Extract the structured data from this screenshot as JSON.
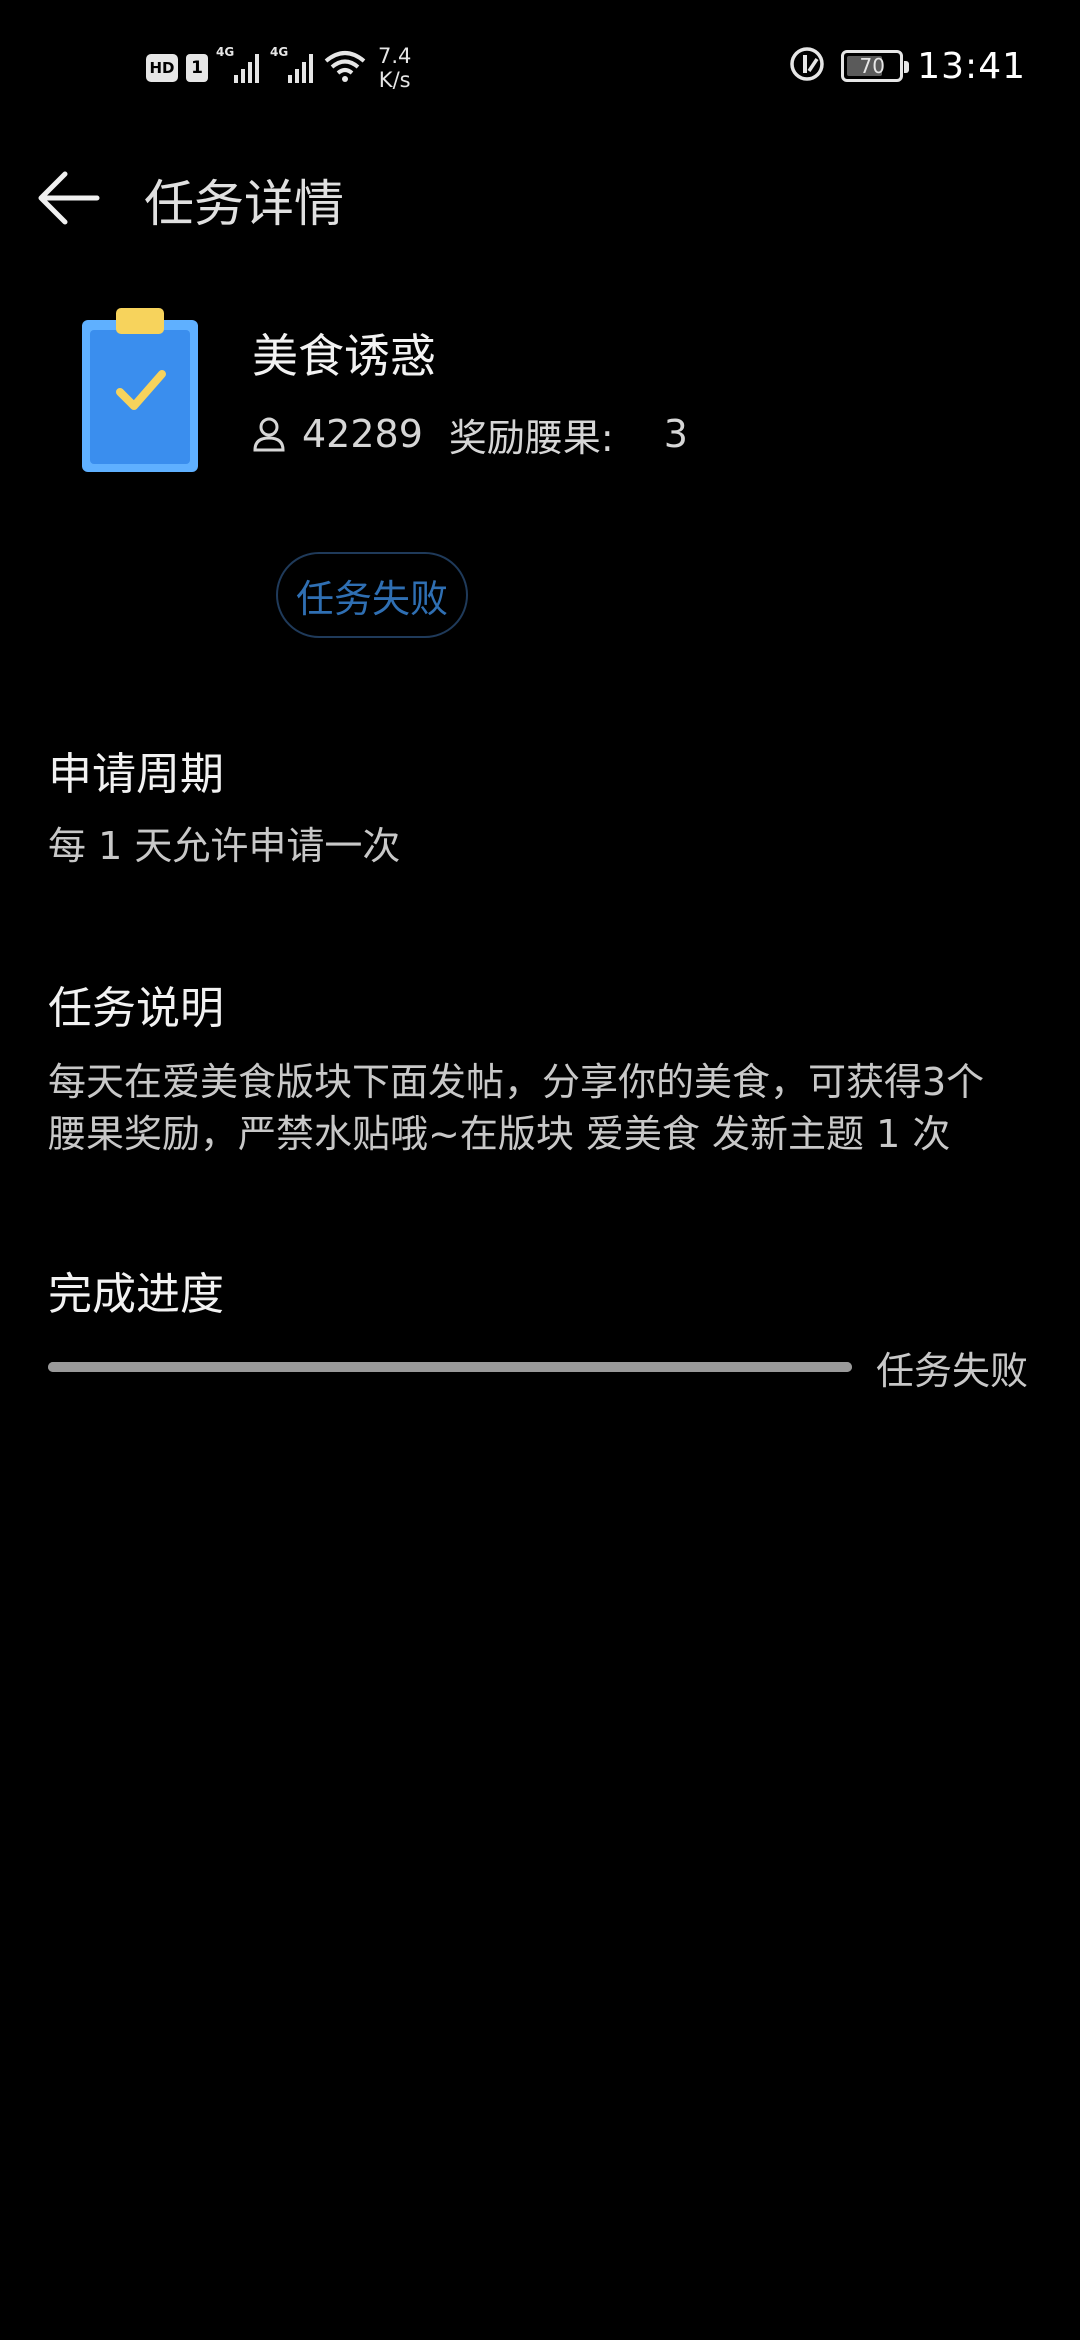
{
  "status_bar": {
    "hd": "HD",
    "sim": "1",
    "network_type_1": "4G",
    "network_type_2": "4G",
    "speed_value": "7.4",
    "speed_unit": "K/s",
    "battery_level": "70",
    "time": "13:41"
  },
  "app_bar": {
    "title": "任务详情"
  },
  "task": {
    "name": "美食诱惑",
    "participants": "42289",
    "reward_label": "奖励腰果:",
    "reward_value": "3",
    "status": "任务失败"
  },
  "sections": {
    "period_title": "申请周期",
    "period_text": "每 1 天允许申请一次",
    "desc_title": "任务说明",
    "desc_line1": "每天在爱美食版块下面发帖，分享你的美食，可获得3个",
    "desc_line2": "腰果奖励，严禁水贴哦~在版块 爱美食 发新主题 1 次",
    "progress_title": "完成进度",
    "progress_status": "任务失败"
  },
  "progress": {
    "fraction": 1.0
  },
  "colors": {
    "background": "#000000",
    "icon_blue": "#3a8eee",
    "icon_clip": "#f7d35c",
    "status_blue": "#2f6fb3"
  }
}
